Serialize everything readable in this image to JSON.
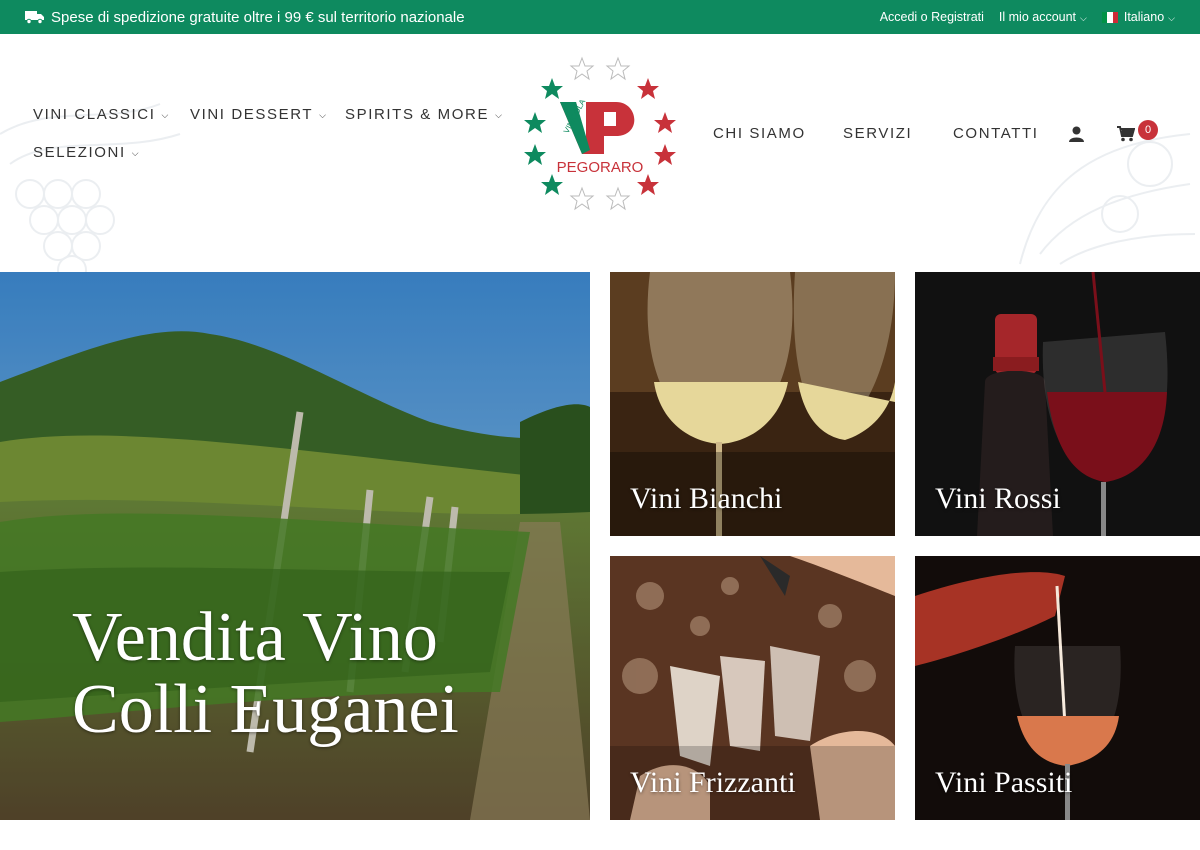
{
  "topbar": {
    "shipping_text": "Spese di spedizione gratuite oltre i 99 € sul territorio nazionale",
    "login_link": "Accedi o Registrati",
    "account_label": "Il mio account",
    "language_label": "Italiano"
  },
  "nav": {
    "left": [
      {
        "label": "VINI CLASSICI"
      },
      {
        "label": "VINI DESSERT"
      },
      {
        "label": "SPIRITS & MORE"
      },
      {
        "label": "SELEZIONI"
      }
    ],
    "right": [
      {
        "label": "CHI SIAMO"
      },
      {
        "label": "SERVIZI"
      },
      {
        "label": "CONTATTI"
      }
    ]
  },
  "logo": {
    "mark": "VP",
    "vinicola": "VINICOLA",
    "name": "PEGORARO"
  },
  "cart": {
    "count": "0"
  },
  "tiles": {
    "hero": "Vendita Vino Colli Euganei",
    "hero_line1": "Vendita Vino",
    "hero_line2": "Colli Euganei",
    "bianchi": "Vini Bianchi",
    "rossi": "Vini Rossi",
    "frizzanti": "Vini Frizzanti",
    "passiti": "Vini Passiti"
  },
  "colors": {
    "brand_green": "#0e8a5f",
    "logo_red": "#c8323a",
    "badge_red": "#c8323a"
  }
}
